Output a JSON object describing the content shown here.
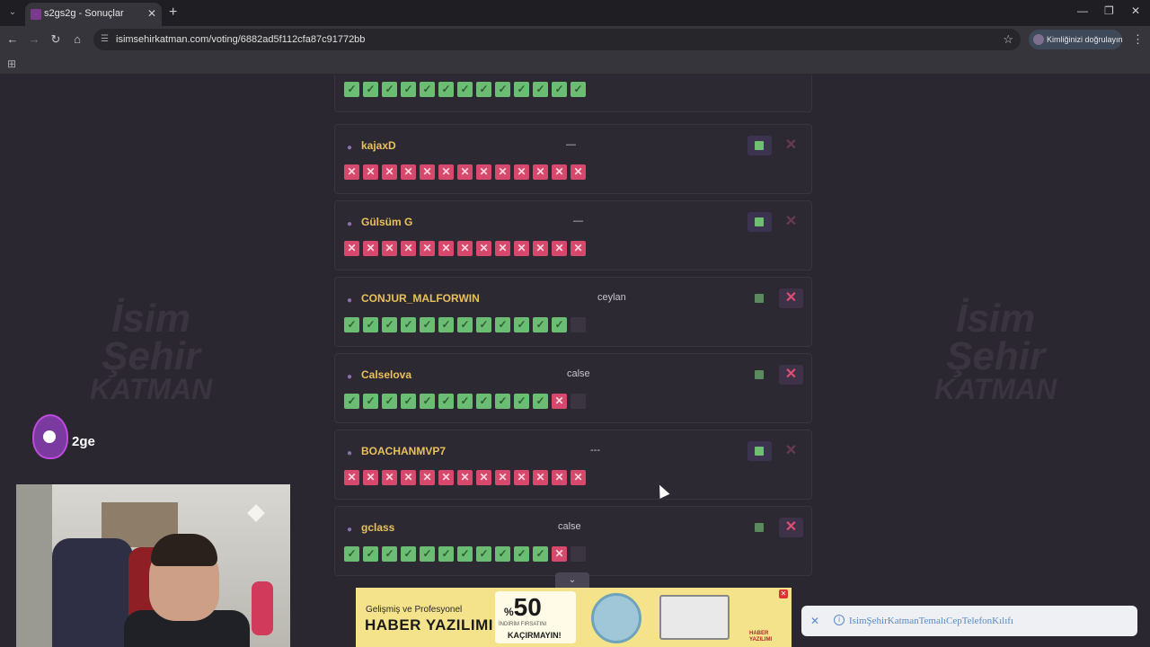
{
  "browser": {
    "tab_title": "s2gs2g - Sonuçlar",
    "url": "isimsehirkatman.com/voting/6882ad5f112cfa87c91772bb",
    "profile_label": "Kimliğinizi doğrulayın",
    "icons": [
      "tab-search-icon",
      "close-icon",
      "plus-icon",
      "minimize-icon",
      "maximize-icon",
      "back-icon",
      "forward-icon",
      "reload-icon",
      "home-icon",
      "site-info-icon",
      "bookmark-star-icon",
      "kebab-menu-icon",
      "apps-grid-icon"
    ]
  },
  "background_logo": {
    "line1": "İsim",
    "line2": "Şehir",
    "line3": "KATMAN"
  },
  "colors": {
    "page_bg": "#2b2730",
    "player_name": "#e8c15a",
    "correct": "#6cbd74",
    "wrong": "#d7486d"
  },
  "rows": [
    {
      "player": "",
      "answer": "",
      "ok_active": false,
      "x_active": false,
      "marks": [
        "ok",
        "ok",
        "ok",
        "ok",
        "ok",
        "ok",
        "ok",
        "ok",
        "ok",
        "ok",
        "ok",
        "ok",
        "ok"
      ]
    },
    {
      "player": "kajaxD",
      "answer": "—",
      "ok_active": true,
      "x_active": false,
      "marks": [
        "no",
        "no",
        "no",
        "no",
        "no",
        "no",
        "no",
        "no",
        "no",
        "no",
        "no",
        "no",
        "no"
      ]
    },
    {
      "player": "Gülsüm G",
      "answer": "—",
      "ok_active": true,
      "x_active": false,
      "marks": [
        "no",
        "no",
        "no",
        "no",
        "no",
        "no",
        "no",
        "no",
        "no",
        "no",
        "no",
        "no",
        "no"
      ]
    },
    {
      "player": "CONJUR_MALFORWIN",
      "answer": "ceylan",
      "ok_active": false,
      "x_active": true,
      "marks": [
        "ok",
        "ok",
        "ok",
        "ok",
        "ok",
        "ok",
        "ok",
        "ok",
        "ok",
        "ok",
        "ok",
        "ok",
        "empty"
      ]
    },
    {
      "player": "Calselova",
      "answer": "calse",
      "ok_active": false,
      "x_active": true,
      "marks": [
        "ok",
        "ok",
        "ok",
        "ok",
        "ok",
        "ok",
        "ok",
        "ok",
        "ok",
        "ok",
        "ok",
        "no",
        "empty"
      ]
    },
    {
      "player": "BOACHANMVP7",
      "answer": "---",
      "ok_active": true,
      "x_active": false,
      "marks": [
        "no",
        "no",
        "no",
        "no",
        "no",
        "no",
        "no",
        "no",
        "no",
        "no",
        "no",
        "no",
        "no"
      ]
    },
    {
      "player": "gclass",
      "answer": "calse",
      "ok_active": false,
      "x_active": true,
      "marks": [
        "ok",
        "ok",
        "ok",
        "ok",
        "ok",
        "ok",
        "ok",
        "ok",
        "ok",
        "ok",
        "ok",
        "no",
        "empty"
      ]
    }
  ],
  "overlay": {
    "brand_text": "2ge"
  },
  "ad": {
    "line1": "Gelişmiş ve Profesyonel",
    "line2": "HABER YAZILIMI",
    "percent_sign": "%",
    "percent": "50",
    "sub1": "İNDİRİM FIRSATINI",
    "sub2": "KAÇIRMAYIN!",
    "brand": "HABER YAZILIMI",
    "toggle": "⌄"
  },
  "notification": {
    "text": "IsimŞehirKatmanTemalıCepTelefonKılıfı"
  }
}
